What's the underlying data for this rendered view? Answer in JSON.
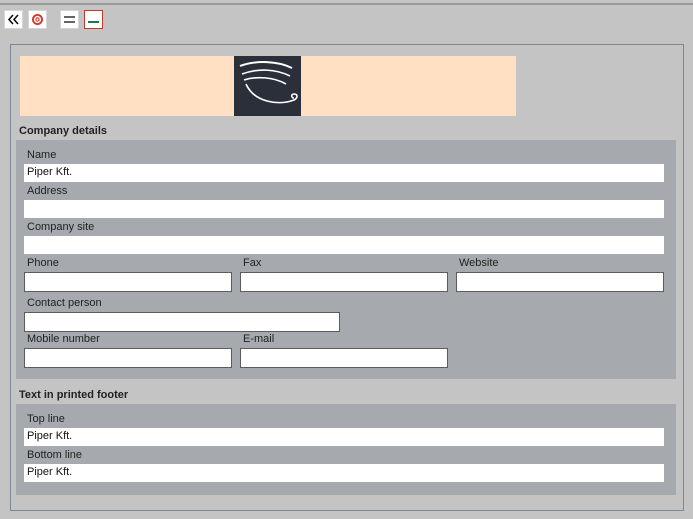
{
  "toolbar": {
    "back_icon": "double-chevron-left-icon",
    "help_icon": "lifebuoy-icon",
    "rows_icon": "two-lines-icon",
    "line_icon": "underline-icon"
  },
  "banner": {
    "background": "#ffe0c2",
    "logo_background": "#2b2f3a"
  },
  "company": {
    "title": "Company details",
    "name_label": "Name",
    "name_value": "Piper Kft.",
    "address_label": "Address",
    "address_value": "",
    "site_label": "Company site",
    "site_value": "",
    "phone_label": "Phone",
    "phone_value": "",
    "fax_label": "Fax",
    "fax_value": "",
    "website_label": "Website",
    "website_value": "",
    "contact_label": "Contact person",
    "contact_value": "",
    "mobile_label": "Mobile number",
    "mobile_value": "",
    "email_label": "E-mail",
    "email_value": ""
  },
  "footer": {
    "title": "Text in printed footer",
    "top_label": "Top line",
    "top_value": "Piper Kft.",
    "bottom_label": "Bottom line",
    "bottom_value": "Piper Kft."
  }
}
